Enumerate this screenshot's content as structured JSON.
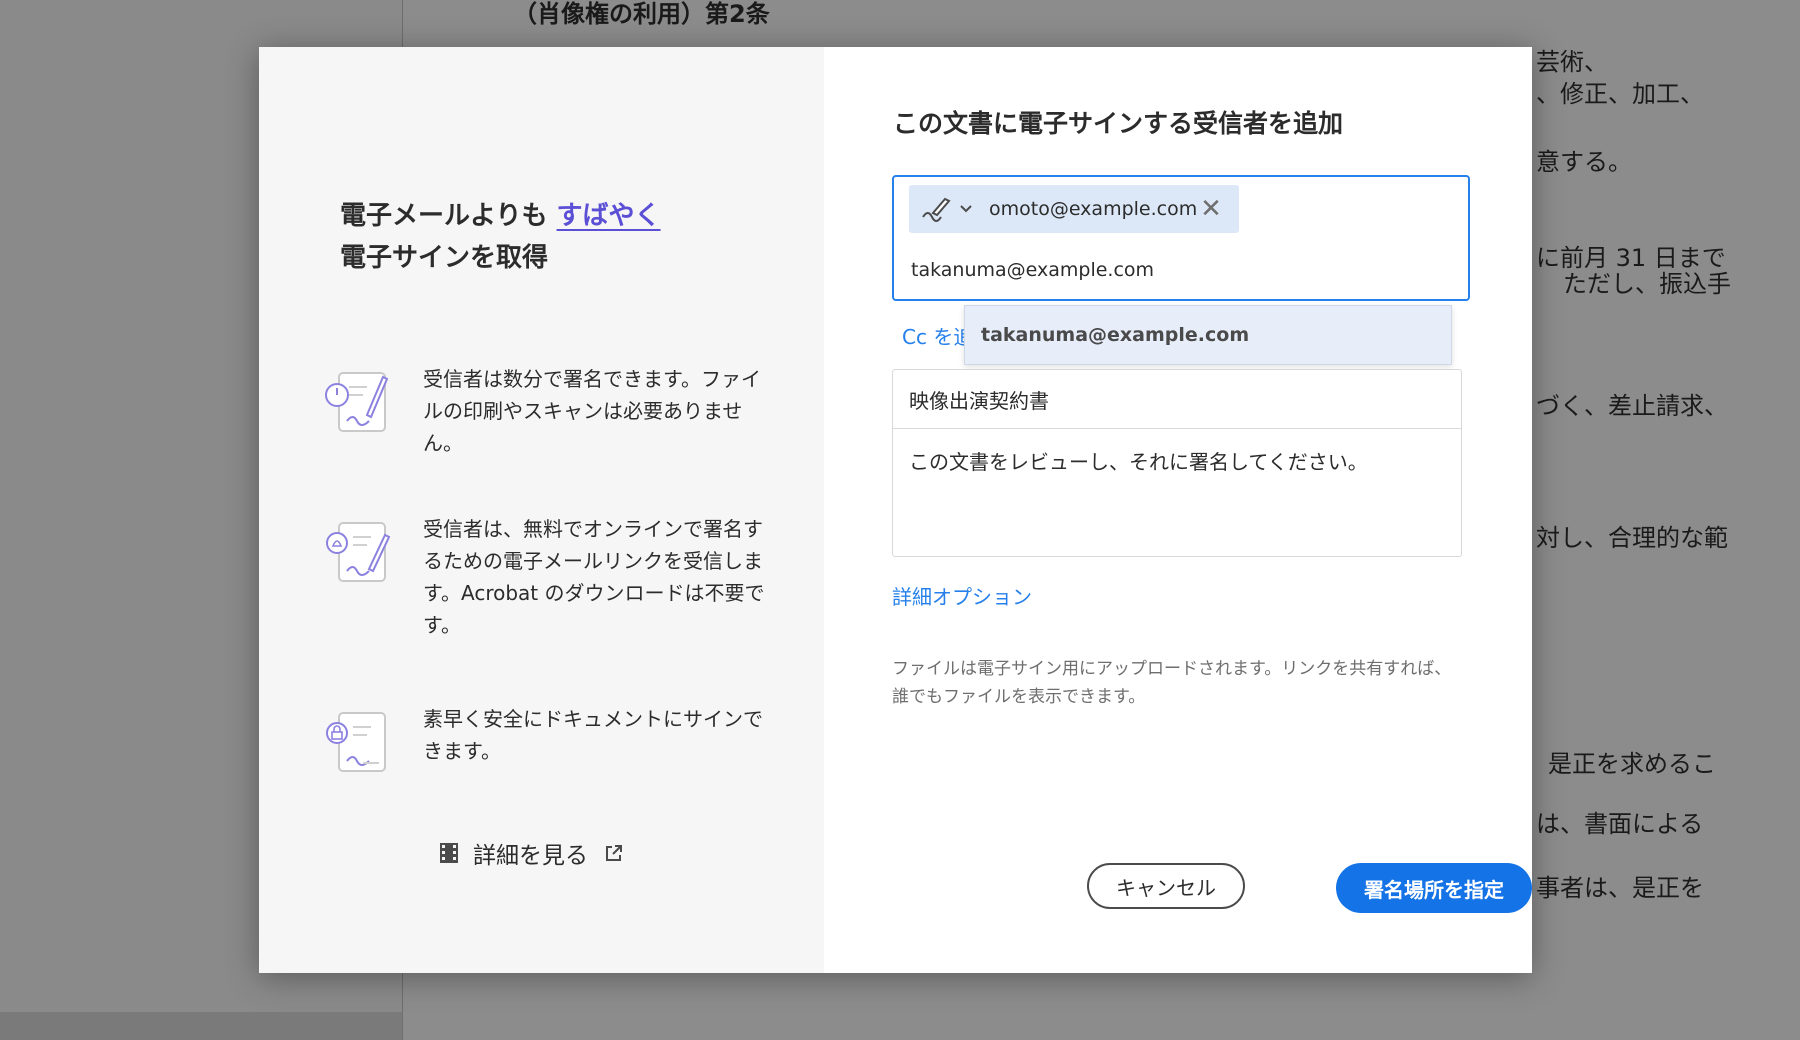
{
  "background_doc": {
    "lines": [
      "（肖像権の利用）第2条",
      "芸術、",
      "、修正、加工、",
      "意する。",
      "に前月 31 日まで",
      "ただし、振込手",
      "づく、差止請求、",
      "対し、合理的な範",
      "是正を求めるこ",
      "は、書面による",
      "事者は、是正を"
    ]
  },
  "left": {
    "headline_part1": "電子メールよりも",
    "headline_accent": "すばやく",
    "headline_part2": "電子サインを取得",
    "features": [
      {
        "icon": "document-sign-timer-icon",
        "text": "受信者は数分で署名できます。ファイルの印刷やスキャンは必要ありません。"
      },
      {
        "icon": "document-notification-sign-icon",
        "text": "受信者は、無料でオンラインで署名するための電子メールリンクを受信します。Acrobat のダウンロードは不要です。"
      },
      {
        "icon": "document-lock-sign-icon",
        "text": "素早く安全にドキュメントにサインできます。"
      }
    ],
    "see_more_label": "詳細を見る"
  },
  "right": {
    "title": "この文書に電子サインする受信者を追加",
    "recipients": [
      {
        "email": "omoto@example.com",
        "role_icon": "pen-sign-icon"
      }
    ],
    "recipient_input_value": "takanuma@example.com",
    "cc_label": "Cc を追加",
    "autocomplete_suggestion": "takanuma@example.com",
    "document_name": "映像出演契約書",
    "message": "この文書をレビューし、それに署名してください。",
    "advanced_options_label": "詳細オプション",
    "notice": "ファイルは電子サイン用にアップロードされます。リンクを共有すれば、誰でもファイルを表示できます。",
    "cancel_label": "キャンセル",
    "primary_label": "署名場所を指定"
  },
  "colors": {
    "accent": "#5b4fd6",
    "link": "#2680eb",
    "primary_button": "#1473e6",
    "chip_bg": "#dce8f8"
  }
}
